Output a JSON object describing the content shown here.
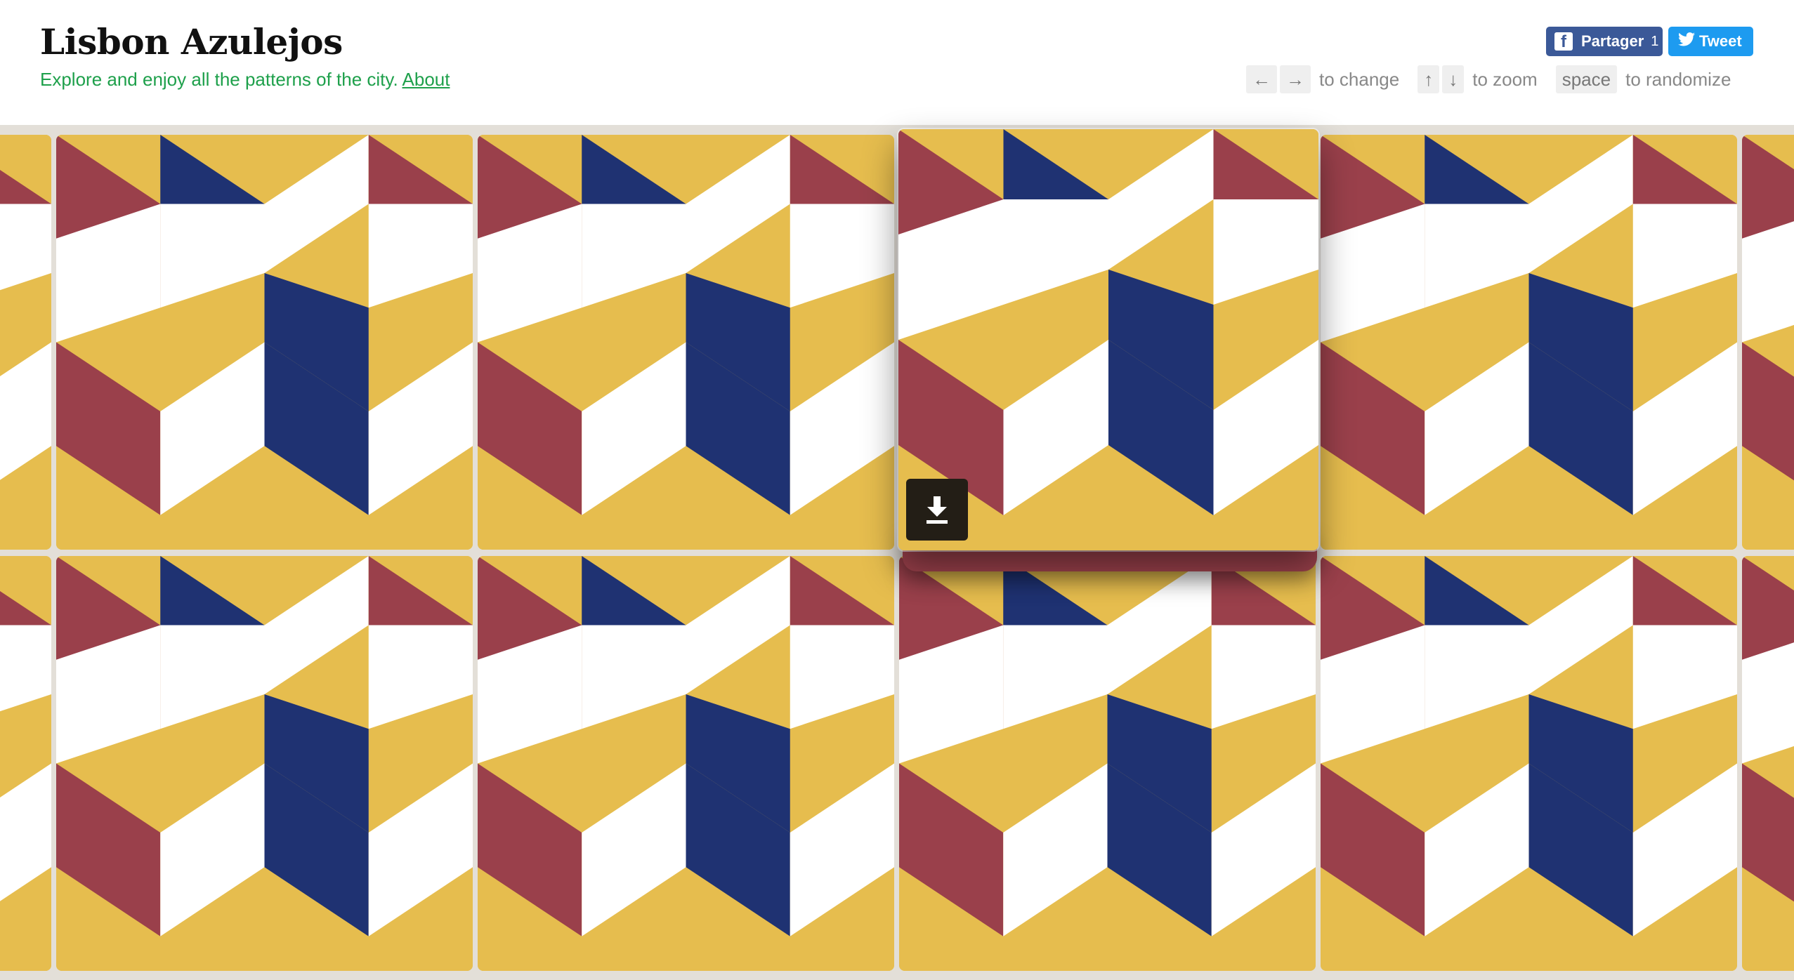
{
  "header": {
    "title": "Lisbon Azulejos",
    "subtitle": "Explore and enjoy all the patterns of the city.",
    "about_link": "About"
  },
  "share": {
    "facebook": {
      "icon": "facebook-icon",
      "label": "Partager",
      "count": "1",
      "color": "#3b5998"
    },
    "twitter": {
      "icon": "twitter-icon",
      "label": "Tweet",
      "color": "#1d9bf0"
    }
  },
  "hints": {
    "change": {
      "keys": [
        "←",
        "→"
      ],
      "text": "to change"
    },
    "zoom": {
      "keys": [
        "↑",
        "↓"
      ],
      "text": "to zoom"
    },
    "randomize": {
      "keys": [
        "space"
      ],
      "text": "to randomize"
    }
  },
  "tile": {
    "pattern": "tumbling blocks (isometric cubes)",
    "colors": {
      "yellow": "#e6bd4e",
      "blue": "#1f3272",
      "red": "#9a404b",
      "white": "#ffffff"
    },
    "grout": "#e3dfd8"
  },
  "download": {
    "icon": "download-icon"
  },
  "text_color_accent": "#1ea04b"
}
